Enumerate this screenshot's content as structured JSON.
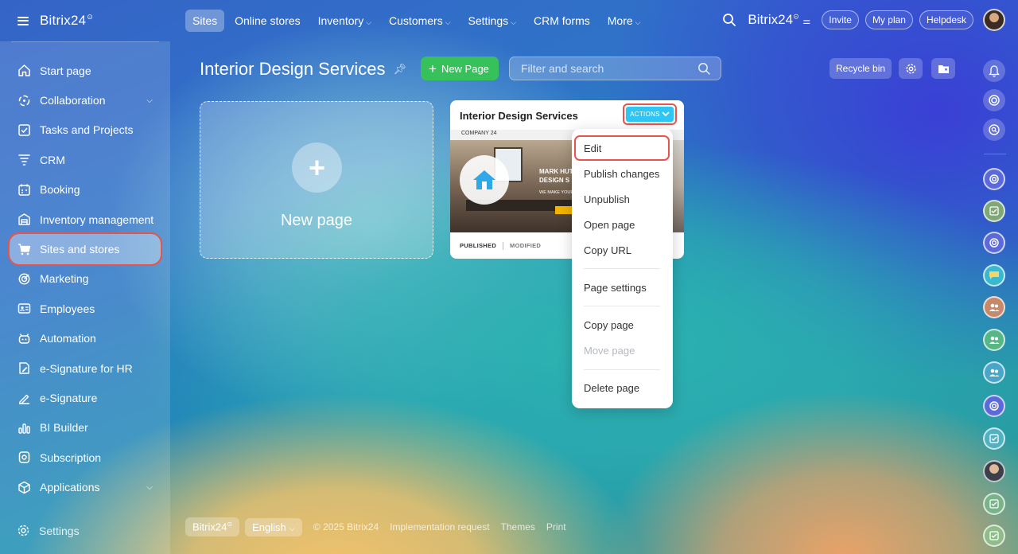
{
  "app": {
    "brand": "Bitrix24",
    "brand_mark": "⊙"
  },
  "topnav": {
    "items": [
      {
        "label": "Sites",
        "active": true,
        "dropdown": false
      },
      {
        "label": "Online stores",
        "active": false,
        "dropdown": false
      },
      {
        "label": "Inventory",
        "active": false,
        "dropdown": true
      },
      {
        "label": "Customers",
        "active": false,
        "dropdown": true
      },
      {
        "label": "Settings",
        "active": false,
        "dropdown": true
      },
      {
        "label": "CRM forms",
        "active": false,
        "dropdown": false
      },
      {
        "label": "More",
        "active": false,
        "dropdown": true
      }
    ],
    "right": {
      "brand": "Bitrix24",
      "invite": "Invite",
      "plan": "My plan",
      "help": "Helpdesk"
    }
  },
  "sidebar": {
    "items": [
      {
        "label": "Start page",
        "icon": "home-icon"
      },
      {
        "label": "Collaboration",
        "icon": "collaboration-icon",
        "expandable": true
      },
      {
        "label": "Tasks and Projects",
        "icon": "tasks-icon"
      },
      {
        "label": "CRM",
        "icon": "crm-icon"
      },
      {
        "label": "Booking",
        "icon": "booking-icon"
      },
      {
        "label": "Inventory management",
        "icon": "inventory-icon"
      },
      {
        "label": "Sites and stores",
        "icon": "cart-icon",
        "selected": true
      },
      {
        "label": "Marketing",
        "icon": "marketing-icon"
      },
      {
        "label": "Employees",
        "icon": "employees-icon"
      },
      {
        "label": "Automation",
        "icon": "automation-icon"
      },
      {
        "label": "e-Signature for HR",
        "icon": "esignature-hr-icon"
      },
      {
        "label": "e-Signature",
        "icon": "esignature-icon"
      },
      {
        "label": "BI Builder",
        "icon": "bi-builder-icon"
      },
      {
        "label": "Subscription",
        "icon": "subscription-icon"
      },
      {
        "label": "Applications",
        "icon": "applications-icon",
        "expandable": true
      }
    ],
    "settings": "Settings"
  },
  "main": {
    "title": "Interior Design Services",
    "new_page_button": "New Page",
    "search_placeholder": "Filter and search",
    "recycle_bin": "Recycle bin",
    "new_page_tile": "New page",
    "card": {
      "title": "Interior Design Services",
      "actions_label": "ACTIONS",
      "preview_company": "COMPANY 24",
      "preview_heading_1": "MARK HUTC",
      "preview_heading_2": "DESIGN S",
      "preview_sub": "WE MAKE YOUR",
      "status_published": "PUBLISHED",
      "status_modified": "MODIFIED"
    },
    "dropdown": {
      "edit": "Edit",
      "publish": "Publish changes",
      "unpublish": "Unpublish",
      "open": "Open page",
      "copy_url": "Copy URL",
      "settings": "Page settings",
      "copy_page": "Copy page",
      "move_page": "Move page",
      "delete": "Delete page"
    }
  },
  "footer": {
    "brand": "Bitrix24",
    "language": "English",
    "copyright": "© 2025 Bitrix24",
    "implementation": "Implementation request",
    "themes": "Themes",
    "print": "Print"
  },
  "colors": {
    "accent_green": "#36c15a",
    "actions_blue": "#2fc6f6",
    "highlight_red": "#e8534a"
  }
}
